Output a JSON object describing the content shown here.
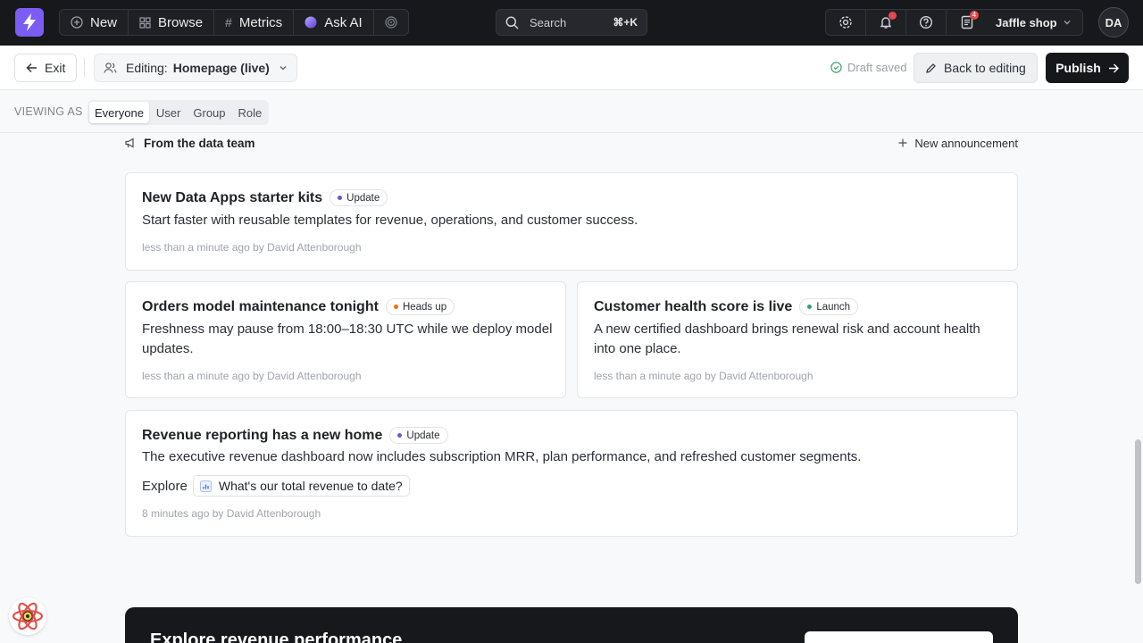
{
  "topnav": {
    "items": [
      {
        "label": "New",
        "icon": "plus-circle-icon"
      },
      {
        "label": "Browse",
        "icon": "grid-icon"
      },
      {
        "label": "Metrics",
        "icon": "hash-icon"
      },
      {
        "label": "Ask AI",
        "icon": "ai-orb-icon"
      }
    ],
    "search": {
      "label": "Search",
      "shortcut": "⌘+K"
    },
    "notification_count": "4",
    "workspace": "Jaffle shop",
    "avatar_initials": "DA"
  },
  "editbar": {
    "exit_label": "Exit",
    "editing_prefix": "Editing:",
    "editing_target": "Homepage (live)",
    "draft_status": "Draft saved",
    "back_label": "Back to editing",
    "publish_label": "Publish"
  },
  "viewing": {
    "label": "VIEWING AS",
    "options": [
      "Everyone",
      "User",
      "Group",
      "Role"
    ],
    "selected": "Everyone"
  },
  "section": {
    "title": "From the data team",
    "new_label": "New announcement"
  },
  "announcements": [
    {
      "title": "New Data Apps starter kits",
      "tag": "Update",
      "tag_color": "#6e56cf",
      "body": "Start faster with reusable templates for revenue, operations, and customer success.",
      "meta": "less than a minute ago by David Attenborough"
    },
    {
      "title": "Orders model maintenance tonight",
      "tag": "Heads up",
      "tag_color": "#f76b15",
      "body": "Freshness may pause from 18:00–18:30 UTC while we deploy model updates.",
      "meta": "less than a minute ago by David Attenborough"
    },
    {
      "title": "Customer health score is live",
      "tag": "Launch",
      "tag_color": "#30a46c",
      "body": "A new certified dashboard brings renewal risk and account health into one place.",
      "meta": "less than a minute ago by David Attenborough"
    },
    {
      "title": "Revenue reporting has a new home",
      "tag": "Update",
      "tag_color": "#6e56cf",
      "body": "The executive revenue dashboard now includes subscription MRR, plan performance, and refreshed customer segments.",
      "explore_label": "Explore",
      "explore_question": "What's our total revenue to date?",
      "meta": "8 minutes ago by David Attenborough"
    }
  ],
  "banner": {
    "title": "Explore revenue performance"
  }
}
